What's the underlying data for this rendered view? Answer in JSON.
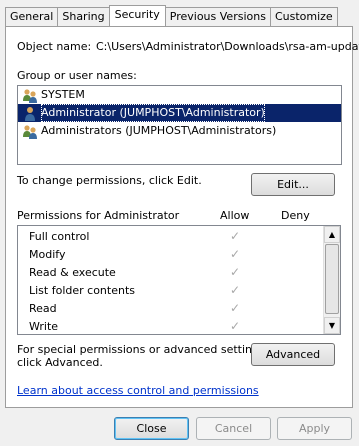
{
  "tabs": [
    "General",
    "Sharing",
    "Security",
    "Previous Versions",
    "Customize"
  ],
  "object": {
    "label": "Object name:",
    "value": "C:\\Users\\Administrator\\Downloads\\rsa-am-update-"
  },
  "groups": {
    "label": "Group or user names:",
    "items": [
      {
        "name": "SYSTEM",
        "icon": "system-users-icon"
      },
      {
        "name": "Administrator (JUMPHOST\\Administrator)",
        "icon": "user-icon",
        "selected": true
      },
      {
        "name": "Administrators (JUMPHOST\\Administrators)",
        "icon": "group-users-icon"
      }
    ]
  },
  "change": {
    "text": "To change permissions, click Edit.",
    "edit_button": "Edit..."
  },
  "permissions": {
    "header": "Permissions for Administrator",
    "allow_label": "Allow",
    "deny_label": "Deny",
    "items": [
      {
        "name": "Full control",
        "allow": true
      },
      {
        "name": "Modify",
        "allow": true
      },
      {
        "name": "Read & execute",
        "allow": true
      },
      {
        "name": "List folder contents",
        "allow": true
      },
      {
        "name": "Read",
        "allow": true
      },
      {
        "name": "Write",
        "allow": true
      }
    ]
  },
  "special": {
    "text_line1": "For special permissions or advanced settings,",
    "text_line2": "click Advanced.",
    "advanced_button": "Advanced"
  },
  "learn_link": "Learn about access control and permissions",
  "footer": {
    "close": "Close",
    "cancel": "Cancel",
    "apply": "Apply"
  }
}
